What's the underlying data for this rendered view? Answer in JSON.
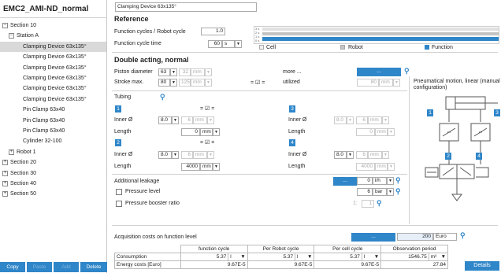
{
  "project_title": "EMC2_AMI-ND_normal",
  "tree": [
    {
      "label": "Section 10",
      "exp": "−"
    },
    {
      "label": "Station A",
      "exp": "−"
    },
    {
      "label": "Clamping Device 63x135°"
    },
    {
      "label": "Clamping Device 63x135°"
    },
    {
      "label": "Clamping Device 63x135°"
    },
    {
      "label": "Clamping Device 63x135°"
    },
    {
      "label": "Clamping Device 63x135°"
    },
    {
      "label": "Clamping Device 63x135°"
    },
    {
      "label": "Pin Clamp 63x40"
    },
    {
      "label": "Pin Clamp 63x40"
    },
    {
      "label": "Pin Clamp 63x40"
    },
    {
      "label": "Cylinder 32-100"
    },
    {
      "label": "Robot 1",
      "exp": "+"
    },
    {
      "label": "Section 20",
      "exp": "+"
    },
    {
      "label": "Section 30",
      "exp": "+"
    },
    {
      "label": "Section 40",
      "exp": "+"
    },
    {
      "label": "Section 50",
      "exp": "+"
    }
  ],
  "left_buttons": {
    "copy": "Copy",
    "paste": "Paste",
    "add": "Add",
    "delete": "Delete"
  },
  "component_name": "Clamping Device 63x135°",
  "reference": {
    "title": "Reference",
    "cycles_label": "Function cycles / Robot cycle",
    "cycles_value": "1.0",
    "time_label": "Function cycle time",
    "time_value": "60",
    "time_unit": "s",
    "bar_ticks": [
      "3 s",
      "2 s",
      "1 s",
      "0 s"
    ],
    "function_fill_fraction": 1.0,
    "legend": {
      "cell": "Cell",
      "robot": "Robot",
      "function": "Function"
    }
  },
  "double_acting": {
    "title": "Double acting, normal",
    "piston_label": "Piston diameter",
    "piston_value": "63",
    "piston_mm": "32",
    "stroke_label": "Stroke max.",
    "stroke_value": "80",
    "stroke_mm": "125",
    "mm": "mm",
    "eq": "= ☑ =",
    "more_label": "more ...",
    "more_btn": "...",
    "utilized_label": "utilized",
    "utilized_value": "80"
  },
  "tubing": {
    "title": "Tubing",
    "n1": "1",
    "n2": "2",
    "n3": "3",
    "n4": "4",
    "eq": "= ☑ =",
    "inner_label": "Inner Ø",
    "length_label": "Length",
    "t1_inner": "8.0",
    "t1_inner_mm": "6",
    "t1_len": "0",
    "t2_inner": "8.0",
    "t2_inner_mm": "6",
    "t2_len": "4000",
    "t3_inner": "8.0",
    "t3_inner_mm": "6",
    "t3_len": "0",
    "t4_inner": "8.0",
    "t4_inner_mm": "6",
    "t4_len": "4000",
    "mm": "mm"
  },
  "leakage": {
    "label": "Additional leakage",
    "btn": "...",
    "value": "0",
    "unit": "l/h",
    "pressure_label": "Pressure level",
    "pressure_value": "6",
    "pressure_unit": "bar",
    "booster_label": "Pressure booster ratio",
    "booster_prefix": "1:",
    "booster_value": "1"
  },
  "pneumatic": {
    "title": "Pneumatical motion, linear (manual configuration)",
    "n1": "1",
    "n2": "2",
    "n3": "3",
    "n4": "4"
  },
  "costs": {
    "label": "Acquisition costs on function level",
    "btn": "...",
    "value": "200",
    "currency": "Euro",
    "headers": [
      "function cycle",
      "Per Robot cycle",
      "Per cell cycle",
      "Observation period"
    ],
    "consumption_label": "Consumption",
    "consumption": [
      "5.37",
      "5.37",
      "5.37",
      "1546.75"
    ],
    "cons_units": [
      "l",
      "l",
      "l",
      "m³"
    ],
    "energy_label": "Energy costs [Euro]",
    "energy": [
      "9.67E-5",
      "9.67E-5",
      "9.67E-5",
      "27.84"
    ],
    "details": "Details"
  },
  "colors": {
    "accent": "#2f86c9",
    "selected": "#d9d9d9"
  }
}
